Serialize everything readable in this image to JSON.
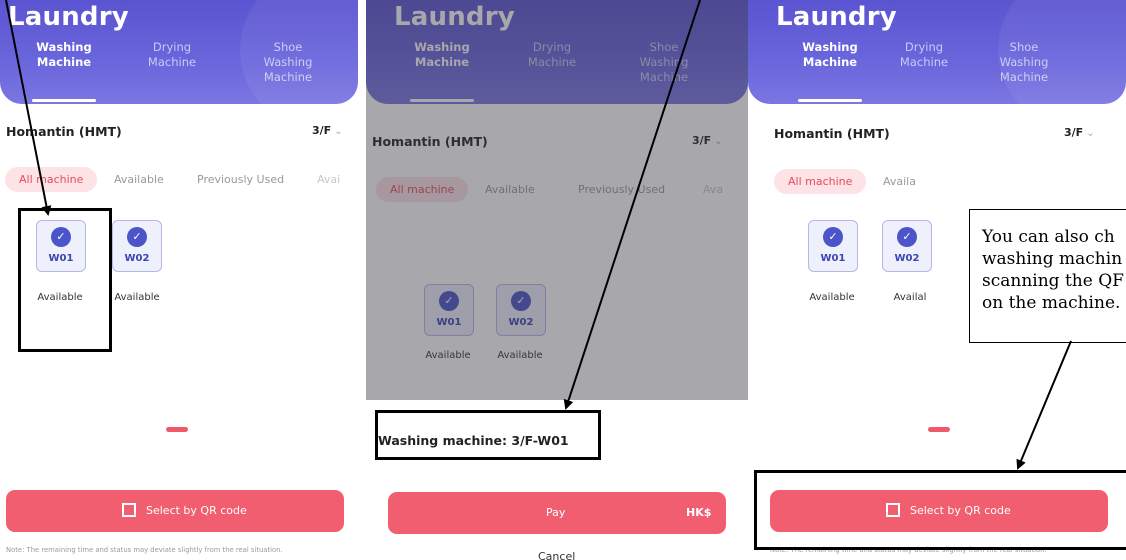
{
  "panel1": {
    "title": "Laundry",
    "tabs": [
      {
        "line1": "Washing",
        "line2": "Machine",
        "line3": ""
      },
      {
        "line1": "Drying",
        "line2": "Machine",
        "line3": ""
      },
      {
        "line1": "Shoe",
        "line2": "Washing",
        "line3": "Machine"
      }
    ],
    "location": "Homantin (HMT)",
    "floor": "3/F",
    "filters": [
      "All machine",
      "Available",
      "Previously Used",
      "Avai"
    ],
    "machines": [
      {
        "code": "W01",
        "status": "Available"
      },
      {
        "code": "W02",
        "status": "Available"
      }
    ],
    "qr_button": "Select by QR code",
    "note": "Note: The remaining time and status may deviate slightly from the real situation."
  },
  "panel2": {
    "title": "Laundry",
    "tabs": [
      {
        "line1": "Washing",
        "line2": "Machine",
        "line3": ""
      },
      {
        "line1": "Drying",
        "line2": "Machine",
        "line3": ""
      },
      {
        "line1": "Shoe",
        "line2": "Washing",
        "line3": "Machine"
      }
    ],
    "location": "Homantin (HMT)",
    "floor": "3/F",
    "filters": [
      "All machine",
      "Available",
      "Previously Used",
      "Ava"
    ],
    "machines": [
      {
        "code": "W01",
        "status": "Available"
      },
      {
        "code": "W02",
        "status": "Available"
      }
    ],
    "sheet_label": "Washing machine: 3/F-W01",
    "pay_label": "Pay",
    "currency": "HK$",
    "cancel_label": "Cancel"
  },
  "panel3": {
    "title": "Laundry",
    "tabs": [
      {
        "line1": "Washing",
        "line2": "Machine",
        "line3": ""
      },
      {
        "line1": "Drying",
        "line2": "Machine",
        "line3": ""
      },
      {
        "line1": "Shoe",
        "line2": "Washing",
        "line3": "Machine"
      }
    ],
    "location": "Homantin (HMT)",
    "floor": "3/F",
    "filters": [
      "All machine",
      "Availa"
    ],
    "machines": [
      {
        "code": "W01",
        "status": "Available"
      },
      {
        "code": "W02",
        "status": "Availal"
      }
    ],
    "qr_button": "Select by QR code",
    "note": "Note: The remaining time and status may deviate slightly from the real situation."
  },
  "callout": {
    "lines": [
      "You can also ch",
      "washing machin",
      "scanning the QF",
      "on the machine."
    ]
  },
  "colors": {
    "header": "#5a54d0",
    "accent": "#f05e6f",
    "machine_check": "#4b55c9",
    "filter_active_bg": "#fde3e6"
  },
  "icons": {
    "check": "check-circle-icon",
    "chevron": "chevron-down-icon",
    "qr": "qr-scan-icon"
  }
}
